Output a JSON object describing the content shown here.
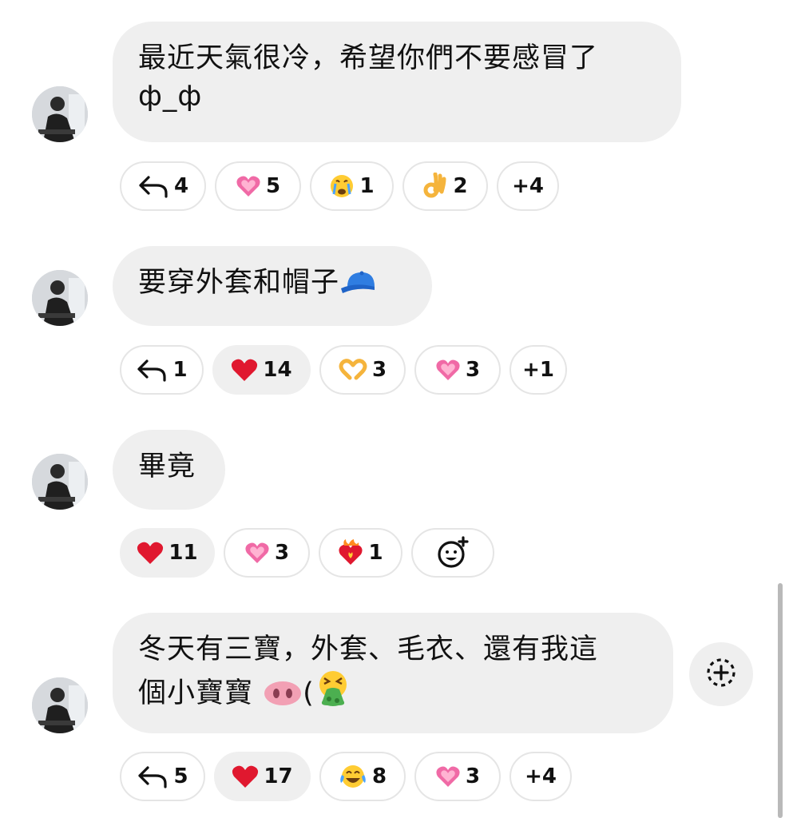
{
  "messages": [
    {
      "lines": [
        "最近天氣很冷，希望你們不要感冒了",
        "ф_ф"
      ],
      "reactions": [
        {
          "icon": "reply-icon",
          "count": "4"
        },
        {
          "icon": "sparkling-heart-icon",
          "count": "5"
        },
        {
          "icon": "crying-face-icon",
          "count": "1"
        },
        {
          "icon": "ok-hand-icon",
          "count": "2"
        },
        {
          "icon": "",
          "count": "+4"
        }
      ]
    },
    {
      "lines": [
        "要穿外套和帽子"
      ],
      "inline_emoji": "blue-cap-icon",
      "reactions": [
        {
          "icon": "reply-icon",
          "count": "1"
        },
        {
          "icon": "red-heart-icon",
          "count": "14",
          "active": true
        },
        {
          "icon": "heart-hands-icon",
          "count": "3"
        },
        {
          "icon": "sparkling-heart-icon",
          "count": "3"
        },
        {
          "icon": "",
          "count": "+1"
        }
      ]
    },
    {
      "lines": [
        "畢竟"
      ],
      "reactions": [
        {
          "icon": "red-heart-icon",
          "count": "11",
          "active": true
        },
        {
          "icon": "sparkling-heart-icon",
          "count": "3"
        },
        {
          "icon": "heart-on-fire-icon",
          "count": "1"
        },
        {
          "icon": "add-reaction-icon",
          "count": ""
        }
      ]
    },
    {
      "lines": [
        "冬天有三寶，外套、毛衣、還有我這",
        "個小寶寶"
      ],
      "line2_suffix": "(",
      "inline_emojis": [
        "pig-nose-icon",
        "vomiting-face-icon"
      ],
      "reactions": [
        {
          "icon": "reply-icon",
          "count": "5"
        },
        {
          "icon": "red-heart-icon",
          "count": "17",
          "active": true
        },
        {
          "icon": "tears-of-joy-icon",
          "count": "8"
        },
        {
          "icon": "sparkling-heart-icon",
          "count": "3"
        },
        {
          "icon": "",
          "count": "+4"
        }
      ]
    }
  ],
  "side_button": {
    "icon": "add-reaction-dotted-icon"
  },
  "colors": {
    "bubble": "#efefef",
    "pill_border": "#e5e5e5",
    "heart": "#e0182f",
    "pink_heart": "#f06aa6"
  }
}
